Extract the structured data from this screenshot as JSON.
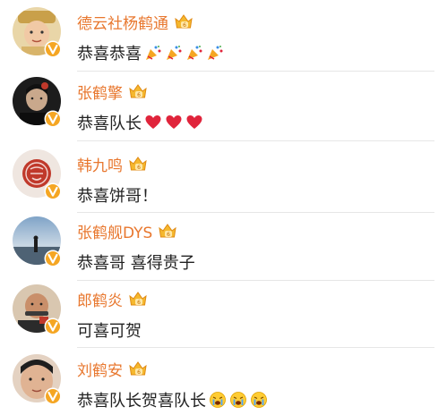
{
  "colors": {
    "name": "#e8772e",
    "text": "#222222",
    "verified_badge": "#f5a623",
    "heart": "#e0243b"
  },
  "comments": [
    {
      "name": "德云社杨鹤通",
      "text": "恭喜恭喜",
      "emoji": "party-popper-icon",
      "emoji_count": 4
    },
    {
      "name": "张鹤擎",
      "text": "恭喜队长",
      "emoji": "red-heart-icon",
      "emoji_count": 3
    },
    {
      "name": "韩九鸣",
      "text": "恭喜饼哥！",
      "emoji": "",
      "emoji_count": 0
    },
    {
      "name": "张鹤舰DYS",
      "text": "恭喜哥 喜得贵子",
      "emoji": "",
      "emoji_count": 0
    },
    {
      "name": "郎鹤炎",
      "text": "可喜可贺",
      "emoji": "",
      "emoji_count": 0
    },
    {
      "name": "刘鹤安",
      "text": "恭喜队长贺喜队长",
      "emoji": "crying-face-icon",
      "emoji_count": 3
    }
  ]
}
